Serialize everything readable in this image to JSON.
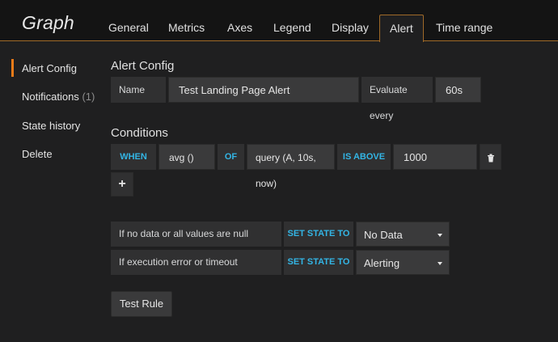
{
  "header": {
    "title": "Graph",
    "tabs": [
      "General",
      "Metrics",
      "Axes",
      "Legend",
      "Display",
      "Alert",
      "Time range"
    ],
    "active_tab": "Alert"
  },
  "sidebar": {
    "items": [
      {
        "label": "Alert Config"
      },
      {
        "label": "Notifications",
        "count": "(1)"
      },
      {
        "label": "State history"
      },
      {
        "label": "Delete"
      }
    ]
  },
  "alert_config": {
    "title": "Alert Config",
    "name_label": "Name",
    "name_value": "Test Landing Page Alert",
    "evaluate_label": "Evaluate every",
    "evaluate_value": "60s"
  },
  "conditions": {
    "title": "Conditions",
    "when": "WHEN",
    "reducer": "avg ()",
    "of": "OF",
    "query": "query (A, 10s, now)",
    "evaluator": "IS ABOVE",
    "threshold": "1000",
    "add_symbol": "+"
  },
  "state_rules": {
    "no_data_label": "If no data or all values are null",
    "no_data_action": "SET STATE TO",
    "no_data_value": "No Data",
    "error_label": "If execution error or timeout",
    "error_action": "SET STATE TO",
    "error_value": "Alerting"
  },
  "test_rule_label": "Test Rule",
  "colors": {
    "accent": "#eb7b18",
    "keyword": "#33b5e5",
    "background": "#1f1f20"
  }
}
